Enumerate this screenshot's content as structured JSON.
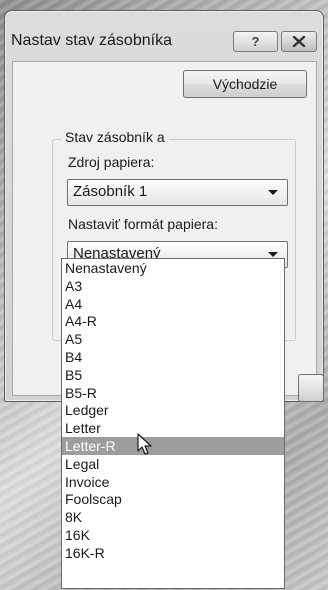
{
  "window": {
    "title": "Nastav stav zásobníka",
    "help_label": "?"
  },
  "toolbar": {
    "defaults_label": "Východzie"
  },
  "group": {
    "title": "Stav zásobník a",
    "source_label": "Zdroj papiera:",
    "source_value": "Zásobník 1",
    "format_label": "Nastaviť formát papiera:",
    "format_value": "Nenastavený"
  },
  "dropdown": {
    "selected_index": 10,
    "options": [
      "Nenastavený",
      "A3",
      "A4",
      "A4-R",
      "A5",
      "B4",
      "B5",
      "B5-R",
      "Ledger",
      "Letter",
      "Letter-R",
      "Legal",
      "Invoice",
      "Foolscap",
      "8K",
      "16K",
      "16K-R"
    ]
  },
  "icons": {
    "help": "question-mark-icon",
    "close": "close-icon",
    "dropdown_arrow": "chevron-down-icon",
    "cursor": "mouse-pointer-icon"
  }
}
